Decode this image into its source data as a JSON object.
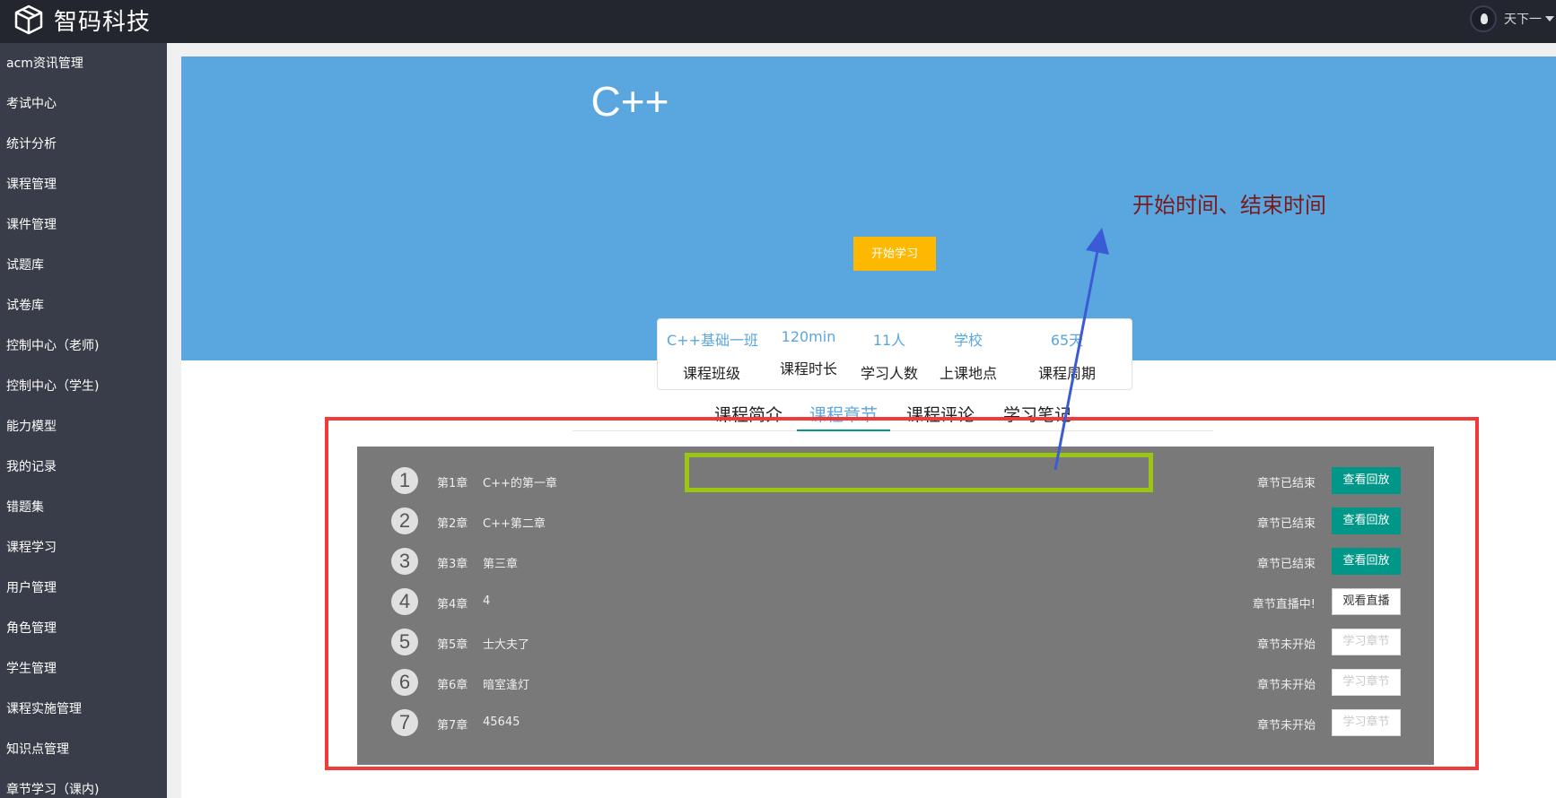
{
  "header": {
    "logo_text": "智码科技",
    "user_name": "天下一"
  },
  "sidebar": {
    "items": [
      {
        "label": "acm资讯管理"
      },
      {
        "label": "考试中心"
      },
      {
        "label": "统计分析"
      },
      {
        "label": "课程管理"
      },
      {
        "label": "课件管理"
      },
      {
        "label": "试题库"
      },
      {
        "label": "试卷库"
      },
      {
        "label": "控制中心（老师)"
      },
      {
        "label": "控制中心（学生)"
      },
      {
        "label": "能力模型"
      },
      {
        "label": "我的记录"
      },
      {
        "label": "错题集"
      },
      {
        "label": "课程学习"
      },
      {
        "label": "用户管理"
      },
      {
        "label": "角色管理"
      },
      {
        "label": "学生管理"
      },
      {
        "label": "课程实施管理"
      },
      {
        "label": "知识点管理"
      },
      {
        "label": "章节学习（课内)"
      }
    ]
  },
  "course": {
    "title": "C++",
    "start_button": "开始学习",
    "stats": [
      {
        "value": "C++基础一班",
        "label": "课程班级"
      },
      {
        "value": "120min",
        "label": "课程时长"
      },
      {
        "value": "11人",
        "label": "学习人数"
      },
      {
        "value": "学校",
        "label": "上课地点"
      },
      {
        "value": "65天",
        "label": "课程周期"
      }
    ]
  },
  "tabs": [
    {
      "label": "课程简介",
      "active": false
    },
    {
      "label": "课程章节",
      "active": true
    },
    {
      "label": "课程评论",
      "active": false
    },
    {
      "label": "学习笔记",
      "active": false
    }
  ],
  "chapters": [
    {
      "num": "1",
      "index": "第1章",
      "name": "C++的第一章",
      "status": "章节已结束",
      "button": "查看回放",
      "kind": "replay"
    },
    {
      "num": "2",
      "index": "第2章",
      "name": "C++第二章",
      "status": "章节已结束",
      "button": "查看回放",
      "kind": "replay"
    },
    {
      "num": "3",
      "index": "第3章",
      "name": "第三章",
      "status": "章节已结束",
      "button": "查看回放",
      "kind": "replay"
    },
    {
      "num": "4",
      "index": "第4章",
      "name": "4",
      "status": "章节直播中!",
      "button": "观看直播",
      "kind": "live"
    },
    {
      "num": "5",
      "index": "第5章",
      "name": "士大夫了",
      "status": "章节未开始",
      "button": "学习章节",
      "kind": "disabled"
    },
    {
      "num": "6",
      "index": "第6章",
      "name": "暗室逢灯",
      "status": "章节未开始",
      "button": "学习章节",
      "kind": "disabled"
    },
    {
      "num": "7",
      "index": "第7章",
      "name": "45645",
      "status": "章节未开始",
      "button": "学习章节",
      "kind": "disabled"
    }
  ],
  "annotation": {
    "text": "开始时间、结束时间"
  },
  "colors": {
    "topbar": "#23262e",
    "sidebar": "#393d49",
    "banner": "#5aa6de",
    "accent_orange": "#ffb800",
    "accent_green": "#009688",
    "annotation_red": "#f03b3b",
    "annotation_green": "#9ac612",
    "annotation_arrow": "#3b5bd6"
  },
  "icons": {
    "logo": "cube-icon",
    "user_menu": "chevron-down-icon"
  }
}
